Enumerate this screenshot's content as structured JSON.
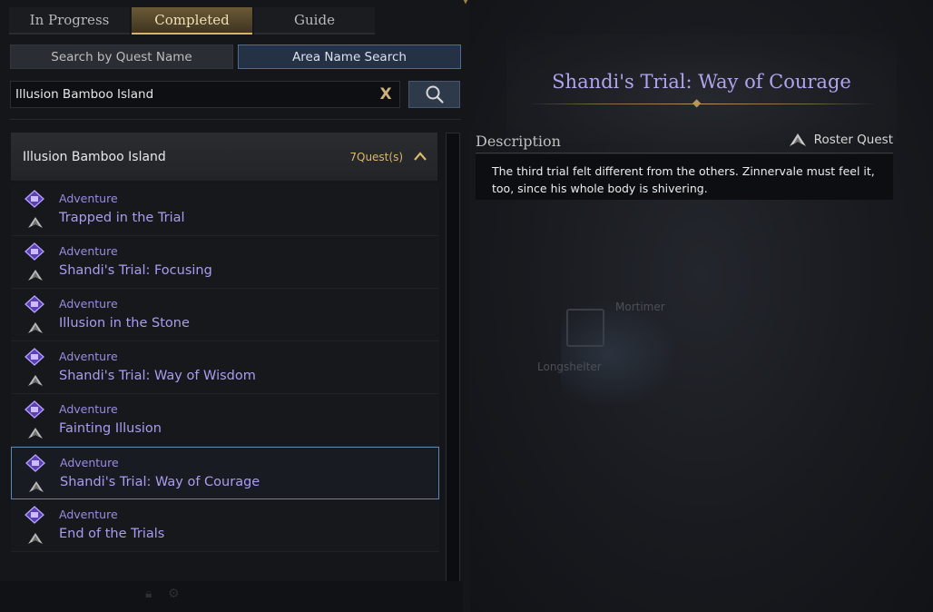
{
  "tabs": [
    {
      "label": "In Progress",
      "active": false
    },
    {
      "label": "Completed",
      "active": true
    },
    {
      "label": "Guide",
      "active": false
    }
  ],
  "search_modes": {
    "quest_name": "Search by Quest Name",
    "area_name": "Area Name Search",
    "selected": "area_name"
  },
  "search": {
    "value": "Illusion Bamboo Island",
    "clear_icon": "close-icon",
    "button_icon": "search-icon"
  },
  "area": {
    "name": "Illusion Bamboo Island",
    "count": "7Quest(s)",
    "expanded": true
  },
  "quests": [
    {
      "type": "Adventure",
      "title": "Trapped in the Trial",
      "selected": false
    },
    {
      "type": "Adventure",
      "title": "Shandi's Trial: Focusing",
      "selected": false
    },
    {
      "type": "Adventure",
      "title": "Illusion in the Stone",
      "selected": false
    },
    {
      "type": "Adventure",
      "title": "Shandi's Trial: Way of Wisdom",
      "selected": false
    },
    {
      "type": "Adventure",
      "title": "Fainting Illusion",
      "selected": false
    },
    {
      "type": "Adventure",
      "title": "Shandi's Trial: Way of Courage",
      "selected": true
    },
    {
      "type": "Adventure",
      "title": "End of the Trials",
      "selected": false
    }
  ],
  "detail": {
    "title": "Shandi's Trial: Way of Courage",
    "description_label": "Description",
    "tag": "Roster Quest",
    "description": "The third trial felt different from the others. Zinnervale must feel it, too, since his whole body is shivering."
  },
  "map": {
    "npc_label": "Mortimer",
    "place_label": "Longshelter"
  },
  "colors": {
    "quest_text": "#a99cf0",
    "accent_gold": "#d9b86a",
    "selected_border": "#5c86b4"
  }
}
